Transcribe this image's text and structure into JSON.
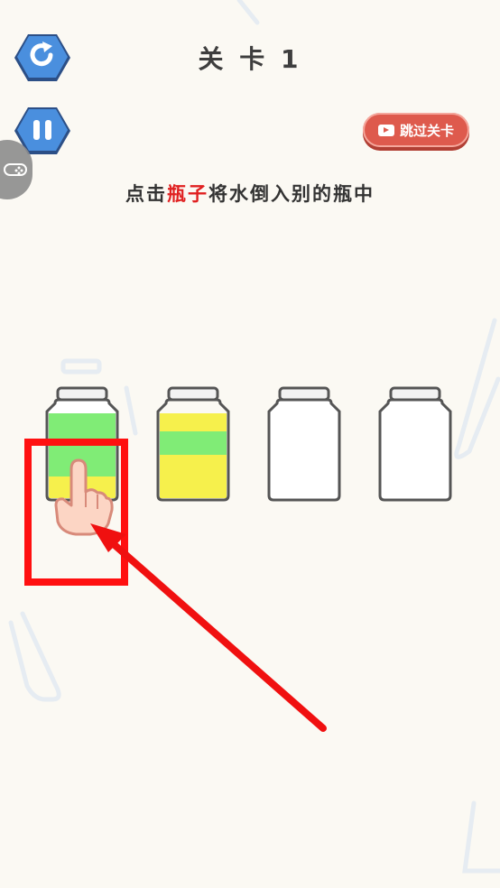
{
  "header": {
    "title": "关 卡 1"
  },
  "buttons": {
    "restart_icon": "refresh-icon",
    "pause_icon": "pause-icon",
    "skip_label": "跳过关卡"
  },
  "instruction": {
    "before": "点击",
    "highlight": "瓶子",
    "after": "将水倒入别的瓶中"
  },
  "bottles": [
    {
      "layers": [
        "yellow",
        "green"
      ]
    },
    {
      "layers": [
        "yellow",
        "green",
        "yellow"
      ]
    },
    {
      "layers": []
    },
    {
      "layers": []
    }
  ],
  "colors": {
    "yellow": "#f6f04c",
    "green": "#80ec76",
    "accent_red": "#e02020",
    "button_blue": "#4a8fde",
    "skip_red": "#de5a4d"
  }
}
